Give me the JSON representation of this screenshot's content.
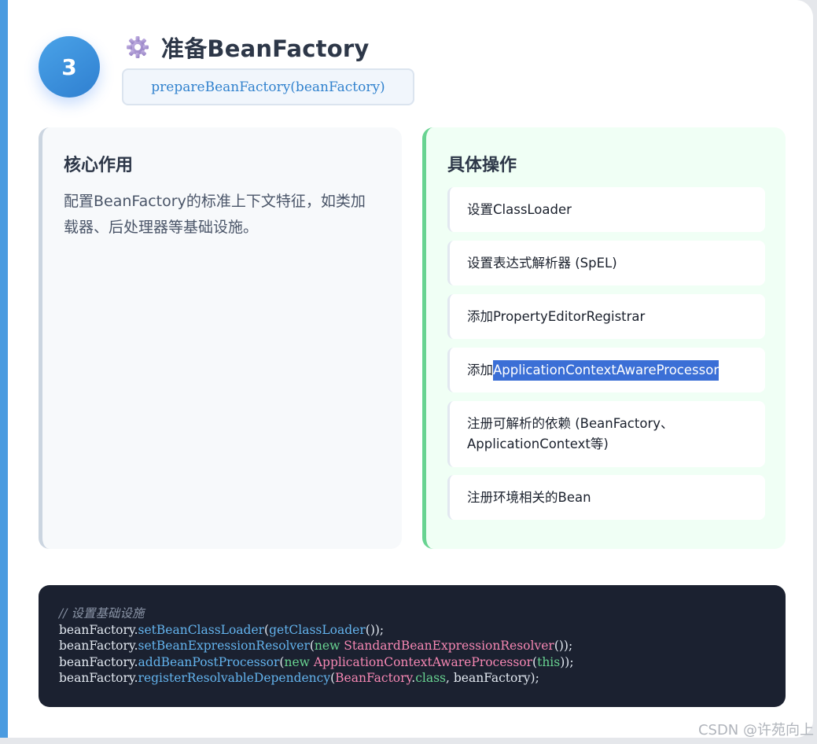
{
  "step": {
    "number": "3"
  },
  "header": {
    "title": "准备BeanFactory",
    "method_signature": "prepareBeanFactory(beanFactory)",
    "icon": "gear-icon"
  },
  "core": {
    "heading": "核心作用",
    "description": "配置BeanFactory的标准上下文特征，如类加载器、后处理器等基础设施。"
  },
  "operations": {
    "heading": "具体操作",
    "items": [
      {
        "text": "设置ClassLoader"
      },
      {
        "text": "设置表达式解析器 (SpEL)"
      },
      {
        "text": "添加PropertyEditorRegistrar"
      },
      {
        "prefix": "添加",
        "highlight": "ApplicationContextAwareProcessor"
      },
      {
        "line1": "注册可解析的依赖 (BeanFactory、",
        "line2": "ApplicationContext等)"
      },
      {
        "text": "注册环境相关的Bean"
      }
    ]
  },
  "code": {
    "comment": "// 设置基础设施",
    "line1": {
      "obj": "beanFactory.",
      "m": "setBeanClassLoader",
      "p1": "(",
      "arg": "getClassLoader",
      "p2": "());"
    },
    "line2": {
      "obj": "beanFactory.",
      "m": "setBeanExpressionResolver",
      "p1": "(",
      "kw": "new ",
      "cls": "StandardBeanExpressionResolver",
      "p2": "());"
    },
    "line3": {
      "obj": "beanFactory.",
      "m": "addBeanPostProcessor",
      "p1": "(",
      "kw": "new ",
      "cls": "ApplicationContextAwareProcessor",
      "p2": "(",
      "kw2": "this",
      "p3": "));"
    },
    "line4": {
      "obj": "beanFactory.",
      "m": "registerResolvableDependency",
      "p1": "(",
      "cls": "BeanFactory",
      "dot": ".",
      "kw": "class",
      "p2": ", beanFactory);"
    }
  },
  "watermark": "CSDN @许苑向上",
  "colors": {
    "accent": "#4a9be0",
    "method_text": "#3182ce",
    "ops_border": "#68d391",
    "highlight": "#3b6fd6",
    "code_bg": "#1b2130"
  }
}
